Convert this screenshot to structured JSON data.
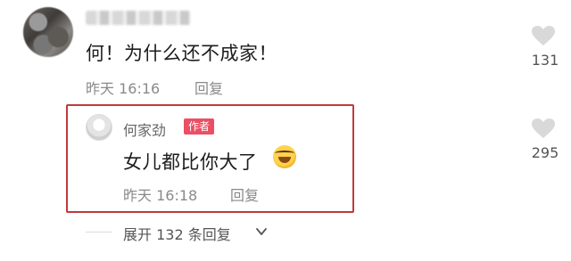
{
  "comment": {
    "text": "何！为什么还不成家！",
    "time": "昨天 16:16",
    "reply_label": "回复",
    "likes": "131"
  },
  "reply": {
    "author": "何家劲",
    "author_tag": "作者",
    "text": "女儿都比你大了",
    "emoji": "rolling-on-floor-laughing",
    "time": "昨天 16:18",
    "reply_label": "回复",
    "likes": "295"
  },
  "expand": {
    "label": "展开 132 条回复"
  },
  "colors": {
    "highlight_border": "#c03a3a",
    "author_tag_bg": "#ea4f64",
    "meta_text": "#8a8a8a"
  }
}
